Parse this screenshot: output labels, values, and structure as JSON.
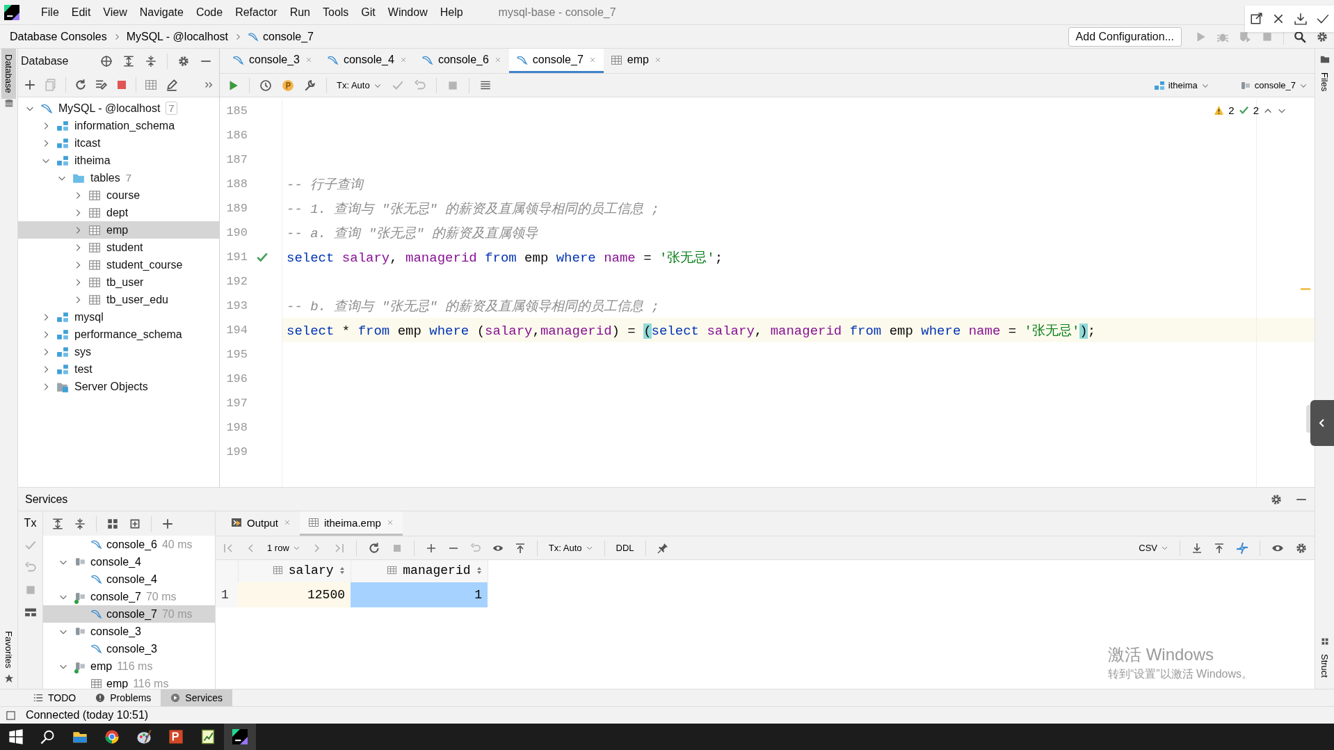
{
  "menu": [
    "File",
    "Edit",
    "View",
    "Navigate",
    "Code",
    "Refactor",
    "Run",
    "Tools",
    "Git",
    "Window",
    "Help"
  ],
  "window": {
    "title": "mysql-base - console_7"
  },
  "breadcrumbs": [
    "Database Consoles",
    "MySQL - @localhost",
    "console_7"
  ],
  "run_config": {
    "label": "Add Configuration..."
  },
  "side_tabs": {
    "left_top": {
      "label": "Database",
      "selected": true
    },
    "left_bottom": {
      "label": "Favorites",
      "selected": false
    },
    "right_top": {
      "label": "Files",
      "selected": false
    },
    "right_bottom": {
      "label": "Struct",
      "selected": false
    }
  },
  "database": {
    "title": "Database",
    "tree": [
      {
        "label": "MySQL - @localhost",
        "count": "7",
        "kind": "datasource",
        "expanded": true,
        "selected": false,
        "children": [
          {
            "label": "information_schema",
            "kind": "schema",
            "expanded": false,
            "selected": false
          },
          {
            "label": "itcast",
            "kind": "schema",
            "expanded": false,
            "selected": false
          },
          {
            "label": "itheima",
            "kind": "schema",
            "expanded": true,
            "selected": false,
            "children": [
              {
                "label": "tables",
                "count": "7",
                "kind": "folder",
                "expanded": true,
                "selected": false,
                "children": [
                  {
                    "label": "course",
                    "kind": "table",
                    "expanded": false,
                    "selected": false
                  },
                  {
                    "label": "dept",
                    "kind": "table",
                    "expanded": false,
                    "selected": false
                  },
                  {
                    "label": "emp",
                    "kind": "table",
                    "expanded": false,
                    "selected": true
                  },
                  {
                    "label": "student",
                    "kind": "table",
                    "expanded": false,
                    "selected": false
                  },
                  {
                    "label": "student_course",
                    "kind": "table",
                    "expanded": false,
                    "selected": false
                  },
                  {
                    "label": "tb_user",
                    "kind": "table",
                    "expanded": false,
                    "selected": false
                  },
                  {
                    "label": "tb_user_edu",
                    "kind": "table",
                    "expanded": false,
                    "selected": false
                  }
                ]
              }
            ]
          },
          {
            "label": "mysql",
            "kind": "schema",
            "expanded": false,
            "selected": false
          },
          {
            "label": "performance_schema",
            "kind": "schema",
            "expanded": false,
            "selected": false
          },
          {
            "label": "sys",
            "kind": "schema",
            "expanded": false,
            "selected": false
          },
          {
            "label": "test",
            "kind": "schema",
            "expanded": false,
            "selected": false
          },
          {
            "label": "Server Objects",
            "kind": "server",
            "expanded": false,
            "selected": false
          }
        ]
      }
    ]
  },
  "editor_tabs": [
    {
      "label": "console_3",
      "kind": "console",
      "selected": false
    },
    {
      "label": "console_4",
      "kind": "console",
      "selected": false
    },
    {
      "label": "console_6",
      "kind": "console",
      "selected": false
    },
    {
      "label": "console_7",
      "kind": "console",
      "selected": true
    },
    {
      "label": "emp",
      "kind": "table",
      "selected": false
    }
  ],
  "editor_toolbar": {
    "tx": "Tx: Auto",
    "schema": "itheima",
    "session": "console_7"
  },
  "inspections": {
    "warnings": "2",
    "ok": "2"
  },
  "lines": [
    {
      "number": "185"
    },
    {
      "number": "186"
    },
    {
      "number": "187"
    },
    {
      "number": "188",
      "tokens": [
        {
          "kind": "comment",
          "text": "-- 行子查询"
        }
      ]
    },
    {
      "number": "189",
      "tokens": [
        {
          "kind": "comment",
          "text": "-- 1. 查询与 \"张无忌\" 的薪资及直属领导相同的员工信息 ;"
        }
      ]
    },
    {
      "number": "190",
      "tokens": [
        {
          "kind": "comment",
          "text": "-- a. 查询 \"张无忌\" 的薪资及直属领导"
        }
      ]
    },
    {
      "number": "191",
      "executed": true,
      "tokens": [
        {
          "kind": "keyword",
          "text": "select"
        },
        {
          "kind": "column",
          "text": " salary"
        },
        {
          "kind": "plain",
          "text": ", "
        },
        {
          "kind": "column",
          "text": "managerid"
        },
        {
          "kind": "keyword",
          "text": " from"
        },
        {
          "kind": "plain",
          "text": " emp "
        },
        {
          "kind": "keyword",
          "text": "where"
        },
        {
          "kind": "column",
          "text": " name"
        },
        {
          "kind": "plain",
          "text": " = "
        },
        {
          "kind": "string",
          "text": "'张无忌'"
        },
        {
          "kind": "plain",
          "text": ";"
        }
      ]
    },
    {
      "number": "192"
    },
    {
      "number": "193",
      "tokens": [
        {
          "kind": "comment",
          "text": "-- b. 查询与 \"张无忌\" 的薪资及直属领导相同的员工信息 ;"
        }
      ]
    },
    {
      "number": "194",
      "current": true,
      "tokens": [
        {
          "kind": "keyword",
          "text": "select"
        },
        {
          "kind": "plain",
          "text": " * "
        },
        {
          "kind": "keyword",
          "text": "from"
        },
        {
          "kind": "plain",
          "text": " emp "
        },
        {
          "kind": "keyword",
          "text": "where"
        },
        {
          "kind": "plain",
          "text": " ("
        },
        {
          "kind": "column",
          "text": "salary"
        },
        {
          "kind": "plain",
          "text": ","
        },
        {
          "kind": "column",
          "text": "managerid"
        },
        {
          "kind": "plain",
          "text": ") = "
        },
        {
          "kind": "brace",
          "text": "("
        },
        {
          "kind": "keyword",
          "text": "select"
        },
        {
          "kind": "column",
          "text": " salary"
        },
        {
          "kind": "plain",
          "text": ", "
        },
        {
          "kind": "column",
          "text": "managerid"
        },
        {
          "kind": "keyword",
          "text": " from"
        },
        {
          "kind": "plain",
          "text": " emp "
        },
        {
          "kind": "keyword",
          "text": "where"
        },
        {
          "kind": "column",
          "text": " name"
        },
        {
          "kind": "plain",
          "text": " = "
        },
        {
          "kind": "string",
          "text": "'张无忌'"
        },
        {
          "kind": "brace",
          "text": ")"
        },
        {
          "kind": "plain",
          "text": ";"
        }
      ]
    },
    {
      "number": "195"
    },
    {
      "number": "196"
    },
    {
      "number": "197"
    },
    {
      "number": "198"
    },
    {
      "number": "199"
    }
  ],
  "services": {
    "title": "Services",
    "tx": "Tx",
    "tree": [
      {
        "label": "console_6",
        "time": "40 ms",
        "kind": "console",
        "selected": false
      },
      {
        "label": "console_4",
        "kind": "session",
        "expanded": true,
        "active": false,
        "selected": false,
        "children": [
          {
            "label": "console_4",
            "kind": "console",
            "selected": false
          }
        ]
      },
      {
        "label": "console_7",
        "time": "70 ms",
        "kind": "session",
        "expanded": true,
        "active": true,
        "selected": false,
        "children": [
          {
            "label": "console_7",
            "time": "70 ms",
            "kind": "console",
            "selected": true
          }
        ]
      },
      {
        "label": "console_3",
        "kind": "session",
        "expanded": true,
        "active": false,
        "selected": false,
        "children": [
          {
            "label": "console_3",
            "kind": "console",
            "selected": false
          }
        ]
      },
      {
        "label": "emp",
        "time": "116 ms",
        "kind": "session",
        "expanded": true,
        "active": true,
        "selected": false,
        "children": [
          {
            "label": "emp",
            "time": "116 ms",
            "kind": "table",
            "selected": false
          }
        ]
      }
    ],
    "result_tabs": [
      {
        "label": "Output",
        "kind": "output",
        "selected": false
      },
      {
        "label": "itheima.emp",
        "kind": "table",
        "selected": true
      }
    ],
    "result_toolbar": {
      "rows": "1 row",
      "tx": "Tx: Auto",
      "ddl": "DDL",
      "format": "CSV"
    },
    "columns": [
      "salary",
      "managerid"
    ],
    "rows": [
      {
        "number": "1",
        "cells": [
          {
            "value": "12500",
            "selected": false
          },
          {
            "value": "1",
            "selected": true
          }
        ]
      }
    ]
  },
  "activation": {
    "title": "激活 Windows",
    "text": "转到“设置”以激活 Windows。"
  },
  "bottom_tabs": [
    {
      "label": "TODO",
      "kind": "todo",
      "selected": false
    },
    {
      "label": "Problems",
      "kind": "problems",
      "selected": false
    },
    {
      "label": "Services",
      "kind": "services",
      "selected": true
    }
  ],
  "status": {
    "text": "Connected (today 10:51)"
  }
}
